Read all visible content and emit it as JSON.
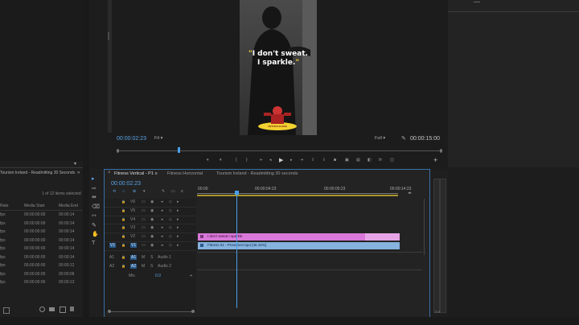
{
  "program_monitor": {
    "caption_line1": "I don't sweat.",
    "caption_line2": "I sparkle.",
    "timecode_current": "00:00:02:23",
    "zoom": "Fit",
    "quality": "Full",
    "timecode_duration": "00:00:15:00",
    "badge_text": "ARTURO ELENA"
  },
  "project_panel": {
    "tab_title": "Tourism Ireland - Readmitting 30 Seconds",
    "items_status": "1 of 12 items selected",
    "columns": [
      "Rate",
      "Media Start",
      "Media End"
    ],
    "rows": [
      {
        "rate": "fps",
        "start": "00:00:00:00",
        "end": "00:00:14"
      },
      {
        "rate": "fps",
        "start": "00:00:00:00",
        "end": "00:00:14"
      },
      {
        "rate": "fps",
        "start": "00:00:00:00",
        "end": "00:00:14"
      },
      {
        "rate": "fps",
        "start": "00:00:00:00",
        "end": "00:00:14"
      },
      {
        "rate": "fps",
        "start": "00:00:00:00",
        "end": "00:00:14"
      },
      {
        "rate": "fps",
        "start": "00:00:00:00",
        "end": "00:00:14"
      },
      {
        "rate": "fps",
        "start": "00:00:00:00",
        "end": "00:00:12"
      },
      {
        "rate": "fps",
        "start": "00:00:00:00",
        "end": "00:00:09"
      },
      {
        "rate": "fps",
        "start": "00:00:00:00",
        "end": "00:00:13"
      }
    ]
  },
  "timeline": {
    "tabs": [
      "Fitness Vertical - P1",
      "Fitness Horizontal",
      "Tourism Ireland - Readmitting 30 seconds"
    ],
    "timecode": "00:00:02:23",
    "ruler_labels": [
      "00:00",
      "00:00:04:23",
      "00:00:09:23",
      "00:00:14:23"
    ],
    "video_tracks": [
      "V6",
      "V5",
      "V4",
      "V3",
      "V2",
      "V1"
    ],
    "audio_tracks": [
      {
        "id": "A1",
        "name": "Audio 1"
      },
      {
        "id": "A2",
        "name": "Audio 2"
      }
    ],
    "mix_label": "Mix",
    "mix_value": "0.0",
    "clip_caption": "I don't sweat I sparkle",
    "clip_video": "Fitness 01 - Prosumer.mp4 [46.15%]",
    "playhead_fraction": 0.175
  },
  "colors": {
    "accent": "#4a9fe8",
    "caption_clip": "#e07be0",
    "video_clip": "#8bb6e0",
    "caption_yellow": "#f2d230"
  },
  "icons": {
    "tool_names": [
      "selection-tool",
      "track-select-tool",
      "ripple-edit-tool",
      "razor-tool",
      "slip-tool",
      "pen-tool",
      "hand-tool",
      "type-tool"
    ]
  }
}
